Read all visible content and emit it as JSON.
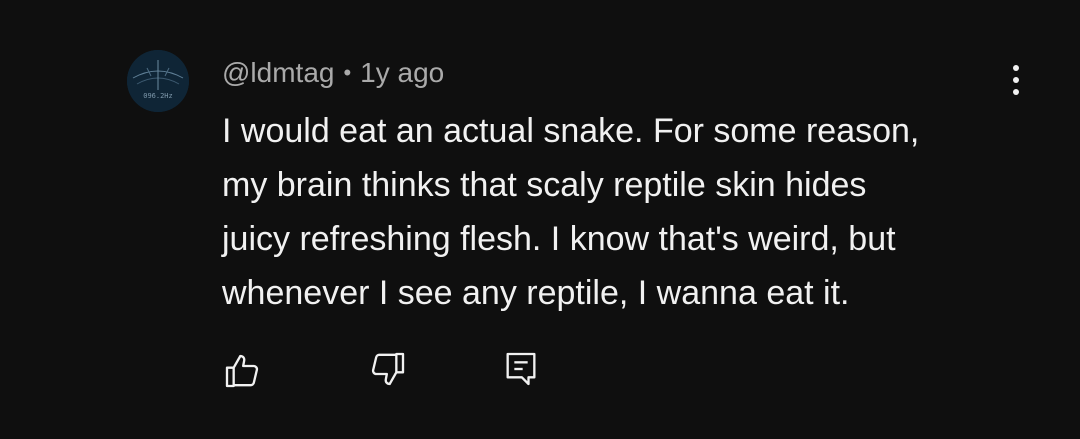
{
  "comment": {
    "author": "@ldmtag",
    "separator": "•",
    "time": "1y ago",
    "avatar_icon": "avatar-image-icon",
    "avatar_text": "096.2Hz",
    "body_lines": [
      "I would eat an actual snake. For some reason,",
      "my brain thinks that scaly reptile skin hides",
      "juicy refreshing flesh. I know that's weird, but",
      "whenever I see any reptile, I wanna eat it."
    ]
  },
  "actions": {
    "like_icon": "thumbs-up-icon",
    "dislike_icon": "thumbs-down-icon",
    "reply_icon": "reply-comment-icon",
    "menu_icon": "more-vertical-icon"
  },
  "colors": {
    "background": "#0f0f0f",
    "text_primary": "#f1f1f1",
    "text_secondary": "#aaaaaa"
  }
}
